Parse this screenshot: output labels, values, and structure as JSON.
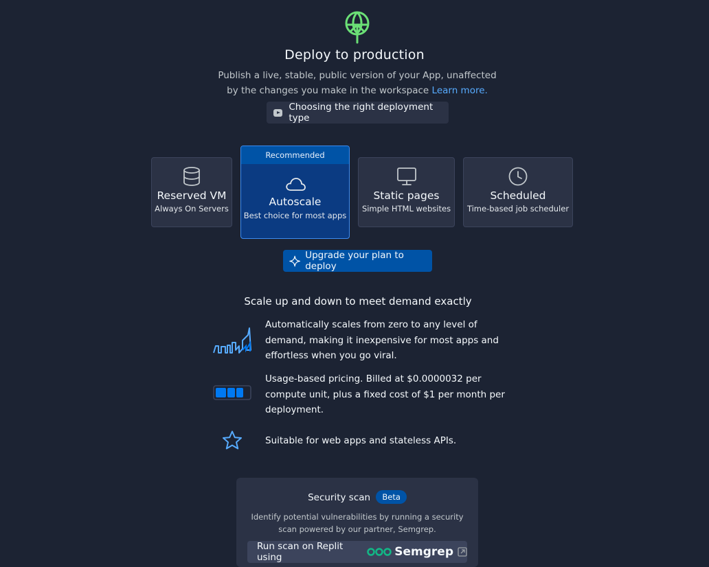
{
  "header": {
    "icon": "deploy-globe-icon",
    "title": "Deploy to production",
    "subtitle": "Publish a live, stable, public version of your App, unaffected by the changes you make in the workspace",
    "learn_more": "Learn more.",
    "video_button": "Choosing the right deployment type"
  },
  "deployment_types": [
    {
      "name": "Reserved VM",
      "desc": "Always On Servers",
      "icon": "database-icon"
    },
    {
      "name": "Autoscale",
      "desc": "Best choice for most apps",
      "icon": "cloud-icon",
      "badge": "Recommended",
      "selected": true
    },
    {
      "name": "Static pages",
      "desc": "Simple HTML websites",
      "icon": "monitor-icon"
    },
    {
      "name": "Scheduled",
      "desc": "Time-based job scheduler",
      "icon": "clock-icon"
    }
  ],
  "upgrade_button": "Upgrade your plan to deploy",
  "section": {
    "title": "Scale up and down to meet demand exactly",
    "features": [
      {
        "icon": "scaling-chart-icon",
        "text": "Automatically scales from zero to any level of demand, making it inexpensive for most apps and effortless when you go viral."
      },
      {
        "icon": "battery-icon",
        "text": "Usage-based pricing. Billed at $0.0000032 per compute unit, plus a fixed cost of $1 per month per deployment."
      },
      {
        "icon": "star-icon",
        "text": "Suitable for web apps and stateless APIs."
      }
    ]
  },
  "security_scan": {
    "title": "Security scan",
    "badge": "Beta",
    "description": "Identify potential vulnerabilities by running a security scan powered by our partner, Semgrep.",
    "button": "Run scan on Replit using",
    "partner_logo": "Semgrep"
  },
  "colors": {
    "background": "#1c2333",
    "card": "#2b3245",
    "accent": "#0053a6",
    "link": "#57abff",
    "icon_green": "#6be076"
  }
}
